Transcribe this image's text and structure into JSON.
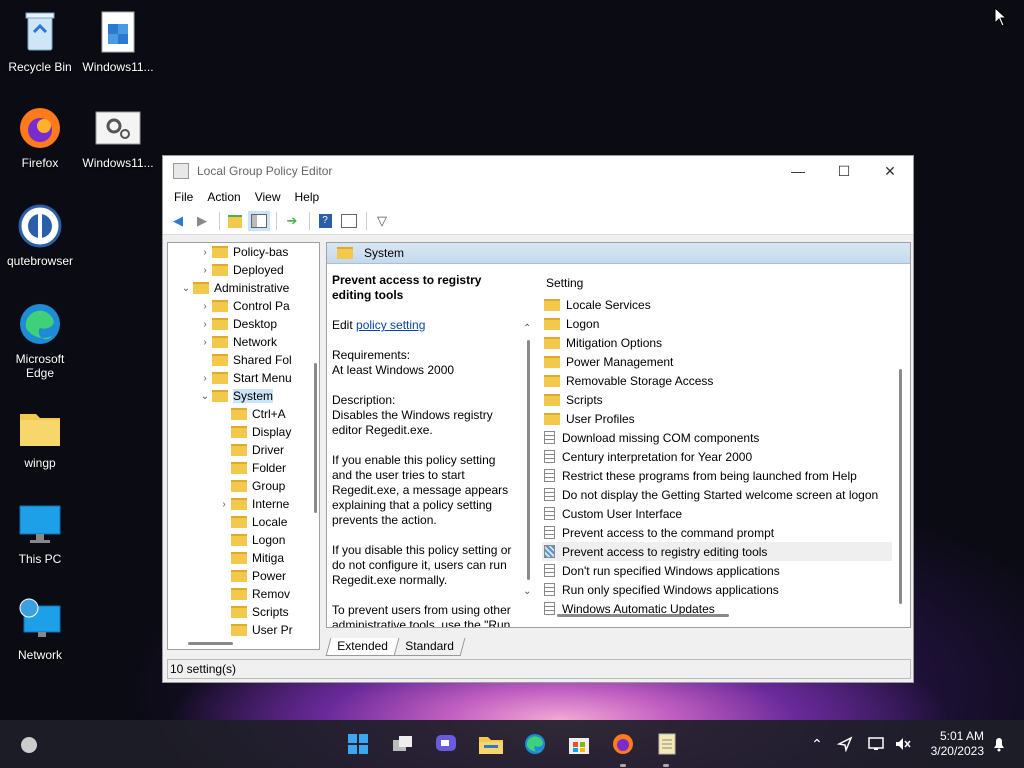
{
  "desktop": {
    "icons": [
      {
        "label": "Recycle Bin"
      },
      {
        "label": "Windows11..."
      },
      {
        "label": "Firefox"
      },
      {
        "label": "Windows11..."
      },
      {
        "label": "qutebrowser"
      },
      {
        "label": "Microsoft Edge"
      },
      {
        "label": "wingp"
      },
      {
        "label": "This PC"
      },
      {
        "label": "Network"
      }
    ]
  },
  "window": {
    "title": "Local Group Policy Editor",
    "controls": {
      "minimize": "—",
      "maximize": "☐",
      "close": "✕"
    },
    "menu": [
      "File",
      "Action",
      "View",
      "Help"
    ],
    "tree": [
      {
        "label": "Policy-bas",
        "indent": 2,
        "chev": "›"
      },
      {
        "label": "Deployed",
        "indent": 2,
        "chev": "›"
      },
      {
        "label": "Administrative",
        "indent": 1,
        "chev": "⌄"
      },
      {
        "label": "Control Pa",
        "indent": 2,
        "chev": "›"
      },
      {
        "label": "Desktop",
        "indent": 2,
        "chev": "›"
      },
      {
        "label": "Network",
        "indent": 2,
        "chev": "›"
      },
      {
        "label": "Shared Fol",
        "indent": 2,
        "chev": ""
      },
      {
        "label": "Start Menu",
        "indent": 2,
        "chev": "›"
      },
      {
        "label": "System",
        "indent": 2,
        "chev": "⌄",
        "selected": true
      },
      {
        "label": "Ctrl+A",
        "indent": 3,
        "chev": ""
      },
      {
        "label": "Display",
        "indent": 3,
        "chev": ""
      },
      {
        "label": "Driver",
        "indent": 3,
        "chev": ""
      },
      {
        "label": "Folder",
        "indent": 3,
        "chev": ""
      },
      {
        "label": "Group",
        "indent": 3,
        "chev": ""
      },
      {
        "label": "Interne",
        "indent": 3,
        "chev": "›"
      },
      {
        "label": "Locale",
        "indent": 3,
        "chev": ""
      },
      {
        "label": "Logon",
        "indent": 3,
        "chev": ""
      },
      {
        "label": "Mitiga",
        "indent": 3,
        "chev": ""
      },
      {
        "label": "Power",
        "indent": 3,
        "chev": ""
      },
      {
        "label": "Remov",
        "indent": 3,
        "chev": ""
      },
      {
        "label": "Scripts",
        "indent": 3,
        "chev": ""
      },
      {
        "label": "User Pr",
        "indent": 3,
        "chev": ""
      }
    ],
    "header": "System",
    "description": {
      "title": "Prevent access to registry editing tools",
      "edit_prefix": "Edit ",
      "edit_link": "policy setting",
      "requirements_label": "Requirements:",
      "requirements": "At least Windows 2000",
      "description_label": "Description:",
      "description": "Disables the Windows registry editor Regedit.exe.",
      "para1": "If you enable this policy setting and the user tries to start Regedit.exe, a message appears explaining that a policy setting prevents the action.",
      "para2": "If you disable this policy setting or do not configure it, users can run Regedit.exe normally.",
      "para3": "To prevent users from using other administrative tools, use the \"Run"
    },
    "settings_header": "Setting",
    "settings": [
      {
        "label": "Locale Services",
        "kind": "folder"
      },
      {
        "label": "Logon",
        "kind": "folder"
      },
      {
        "label": "Mitigation Options",
        "kind": "folder"
      },
      {
        "label": "Power Management",
        "kind": "folder"
      },
      {
        "label": "Removable Storage Access",
        "kind": "folder"
      },
      {
        "label": "Scripts",
        "kind": "folder"
      },
      {
        "label": "User Profiles",
        "kind": "folder"
      },
      {
        "label": "Download missing COM components",
        "kind": "policy"
      },
      {
        "label": "Century interpretation for Year 2000",
        "kind": "policy"
      },
      {
        "label": "Restrict these programs from being launched from Help",
        "kind": "policy"
      },
      {
        "label": "Do not display the Getting Started welcome screen at logon",
        "kind": "policy"
      },
      {
        "label": "Custom User Interface",
        "kind": "policy"
      },
      {
        "label": "Prevent access to the command prompt",
        "kind": "policy"
      },
      {
        "label": "Prevent access to registry editing tools",
        "kind": "policy",
        "selected": true
      },
      {
        "label": "Don't run specified Windows applications",
        "kind": "policy"
      },
      {
        "label": "Run only specified Windows applications",
        "kind": "policy"
      },
      {
        "label": "Windows Automatic Updates",
        "kind": "policy"
      }
    ],
    "tabs": [
      "Extended",
      "Standard"
    ],
    "status": "10 setting(s)"
  },
  "taskbar": {
    "time": "5:01 AM",
    "date": "3/20/2023"
  }
}
